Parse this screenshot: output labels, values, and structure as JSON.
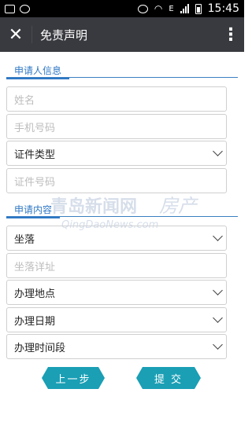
{
  "status_bar": {
    "time": "15:45",
    "network": "E"
  },
  "header": {
    "title": "免责声明"
  },
  "applicant_section": {
    "label": "申请人信息"
  },
  "applicant_fields": {
    "name_placeholder": "姓名",
    "phone_placeholder": "手机号码",
    "id_type_value": "证件类型",
    "id_number_placeholder": "证件号码"
  },
  "request_section": {
    "label": "申请内容"
  },
  "request_fields": {
    "location_value": "坐落",
    "location_detail_placeholder": "坐落详址",
    "office_value": "办理地点",
    "date_value": "办理日期",
    "time_slot_value": "办理时间段"
  },
  "watermark": {
    "brand": "青岛新闻网",
    "url": "QingDaoNews.com",
    "channel": "房产"
  },
  "buttons": {
    "prev_label": "上一步",
    "submit_label": "提 交"
  },
  "colors": {
    "accent": "#2f78c5",
    "button": "#1a9fb5",
    "topbar": "#393a3f"
  }
}
